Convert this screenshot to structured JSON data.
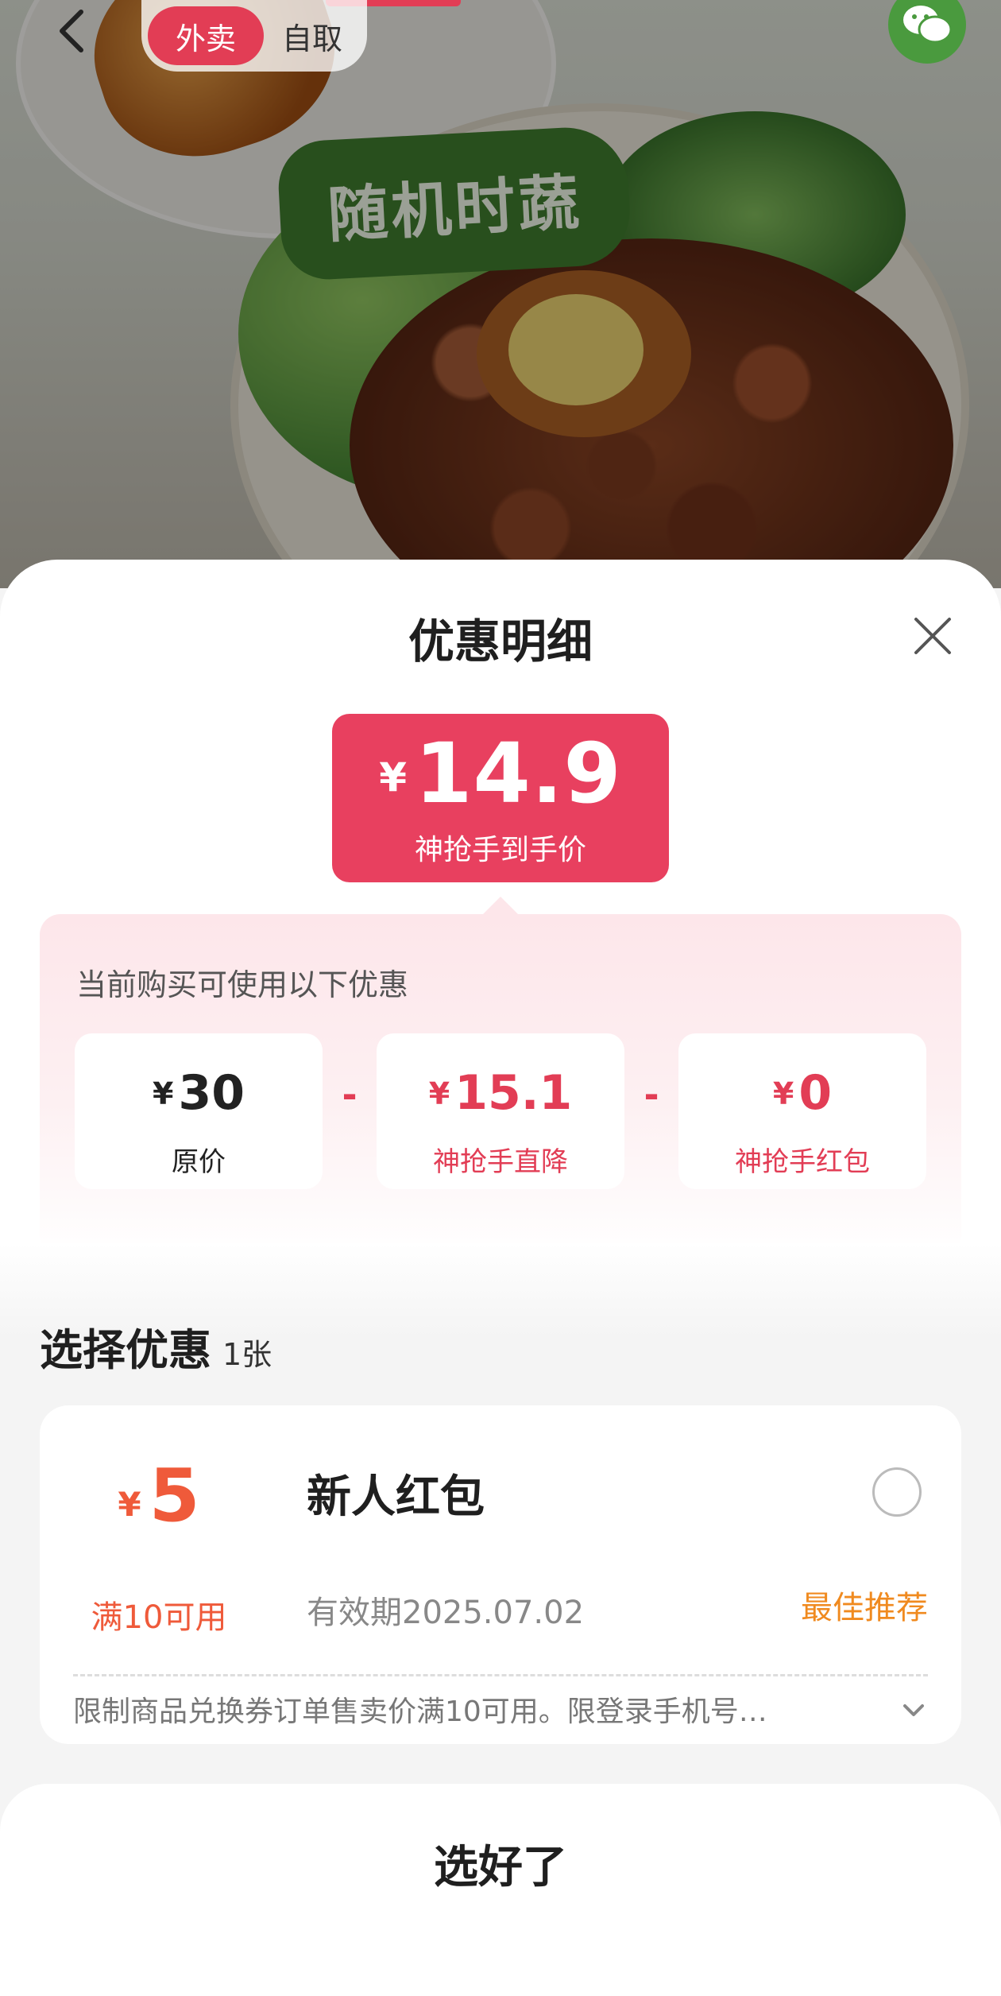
{
  "topbar": {
    "delivery_tab": "外卖",
    "pickup_tab": "自取"
  },
  "photo": {
    "tag": "随机时蔬"
  },
  "sheet": {
    "title": "优惠明细",
    "final_price": {
      "currency": "¥",
      "amount": "14.9",
      "label": "神抢手到手价"
    },
    "calc": {
      "caption": "当前购买可使用以下优惠",
      "items": [
        {
          "currency": "¥",
          "amount": "30",
          "label": "原价"
        },
        {
          "currency": "¥",
          "amount": "15.1",
          "label": "神抢手直降"
        },
        {
          "currency": "¥",
          "amount": "0",
          "label": "神抢手红包"
        }
      ],
      "operator": "-"
    },
    "select_section": {
      "title": "选择优惠",
      "count": "1张"
    },
    "coupon": {
      "currency": "¥",
      "amount": "5",
      "condition": "满10可用",
      "name": "新人红包",
      "validity": "有效期2025.07.02",
      "badge": "最佳推荐",
      "selected": false,
      "description": "限制商品兑换券订单售卖价满10可用。限登录手机号…"
    },
    "confirm_label": "选好了"
  },
  "colors": {
    "accent": "#e8405f",
    "coupon_orange": "#ef5a3a",
    "badge_orange": "#f08a1f"
  }
}
